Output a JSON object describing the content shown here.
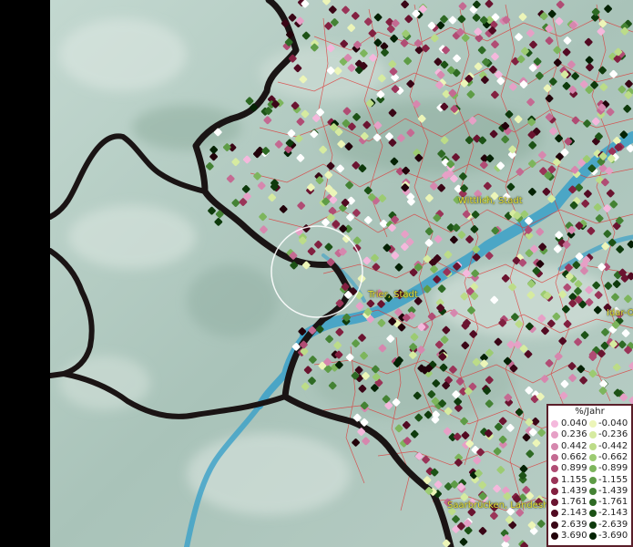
{
  "cities": [
    {
      "label": "Wittlich, Stadt"
    },
    {
      "label": "Trier, Stadt"
    },
    {
      "label": "Idar-O"
    },
    {
      "label": "Saarbrücken, Landesh"
    }
  ],
  "legend": {
    "title": "%/Jahr",
    "positive": [
      {
        "value": "0.040",
        "color": "#f4b8dc"
      },
      {
        "value": "0.236",
        "color": "#e6a0c6"
      },
      {
        "value": "0.442",
        "color": "#d687ae"
      },
      {
        "value": "0.662",
        "color": "#c46a92"
      },
      {
        "value": "0.899",
        "color": "#b04c74"
      },
      {
        "value": "1.155",
        "color": "#9a3458"
      },
      {
        "value": "1.439",
        "color": "#822040"
      },
      {
        "value": "1.761",
        "color": "#6a1430"
      },
      {
        "value": "2.143",
        "color": "#520a22"
      },
      {
        "value": "2.639",
        "color": "#3a0616"
      },
      {
        "value": "3.690",
        "color": "#22020a"
      }
    ],
    "negative": [
      {
        "value": "-0.040",
        "color": "#ecf5b8"
      },
      {
        "value": "-0.236",
        "color": "#d6eba0"
      },
      {
        "value": "-0.442",
        "color": "#bcdc88"
      },
      {
        "value": "-0.662",
        "color": "#9ccb72"
      },
      {
        "value": "-0.899",
        "color": "#7db55c"
      },
      {
        "value": "-1.155",
        "color": "#5e9c46"
      },
      {
        "value": "-1.439",
        "color": "#448234"
      },
      {
        "value": "-1.761",
        "color": "#2e6a24"
      },
      {
        "value": "-2.143",
        "color": "#1c5216"
      },
      {
        "value": "-2.639",
        "color": "#0e3a0c"
      },
      {
        "value": "-3.690",
        "color": "#042204"
      }
    ]
  },
  "colors": {
    "terrain": "#b8cfc6",
    "water": "#3aa0c8",
    "border": "#1a1414",
    "admin_lines": "#e03030",
    "label": "#e8e23a",
    "highlight": "#ffffff"
  }
}
